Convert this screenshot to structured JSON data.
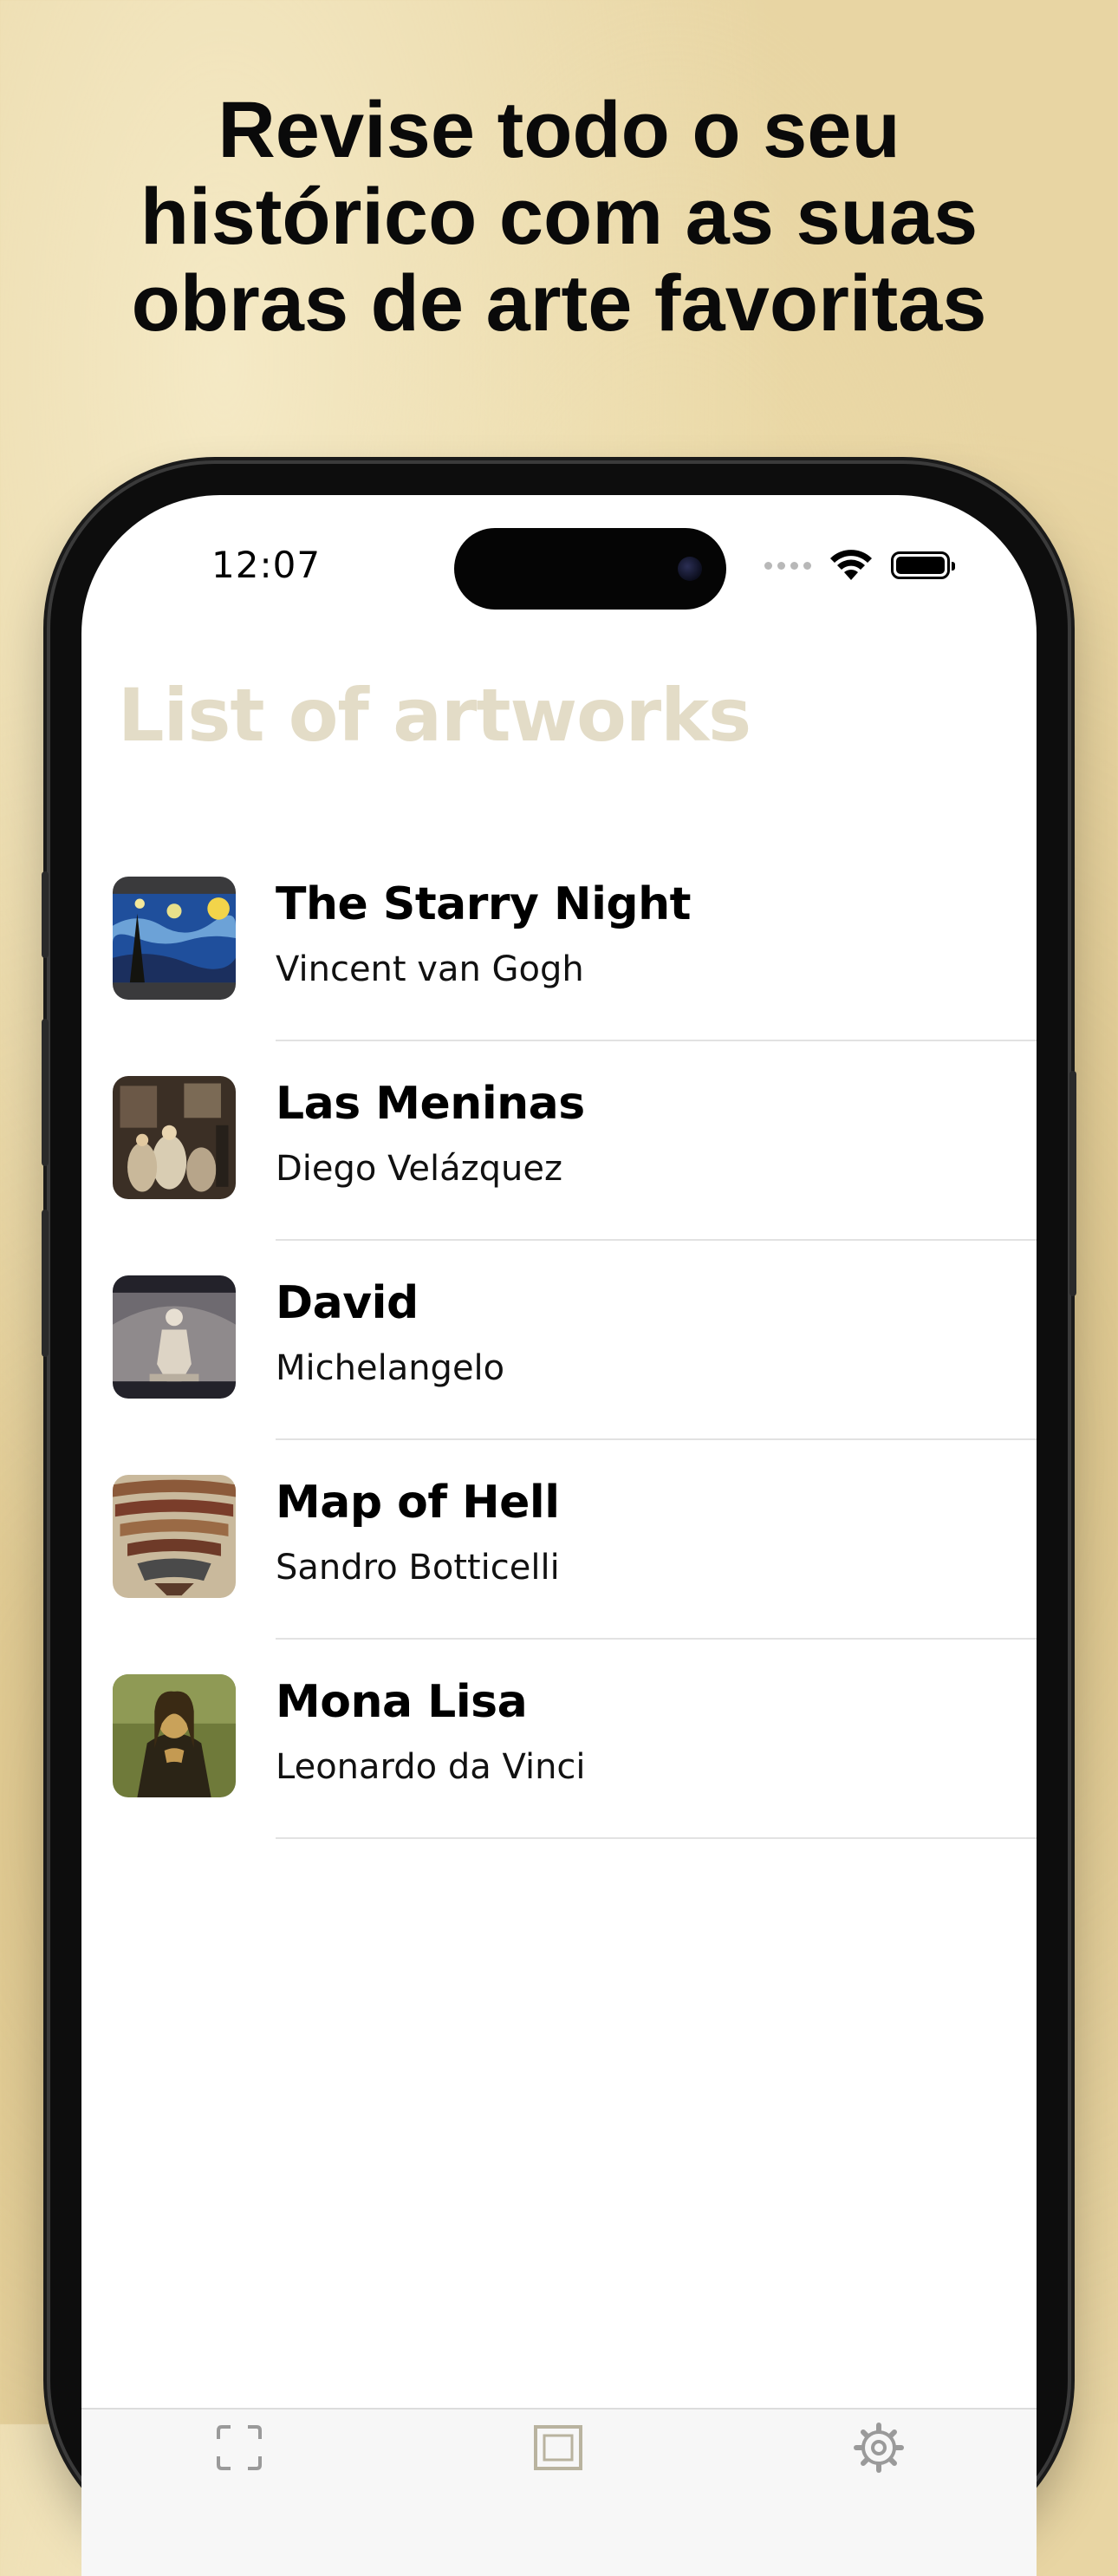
{
  "headline": {
    "line1": "Revise todo o seu",
    "line2": "histórico com as suas",
    "line3": "obras de arte favoritas"
  },
  "status_bar": {
    "time": "12:07",
    "icons": [
      "cellular-dots-icon",
      "wifi-icon",
      "battery-icon"
    ]
  },
  "screen": {
    "title": "List of artworks",
    "title_color": "#e3dcc7"
  },
  "artworks": [
    {
      "title": "The Starry Night",
      "artist": "Vincent van Gogh",
      "thumbnail": "starry-night-thumbnail"
    },
    {
      "title": "Las Meninas",
      "artist": "Diego Velázquez",
      "thumbnail": "las-meninas-thumbnail"
    },
    {
      "title": "David",
      "artist": "Michelangelo",
      "thumbnail": "david-thumbnail"
    },
    {
      "title": "Map of Hell",
      "artist": "Sandro Botticelli",
      "thumbnail": "map-of-hell-thumbnail"
    },
    {
      "title": "Mona Lisa",
      "artist": "Leonardo da Vinci",
      "thumbnail": "mona-lisa-thumbnail"
    }
  ],
  "tab_bar": {
    "tabs": [
      {
        "icon": "scan-icon"
      },
      {
        "icon": "artwork-frame-icon"
      },
      {
        "icon": "settings-gear-icon"
      }
    ]
  },
  "colors": {
    "background": "#e8d5a3",
    "text": "#000000",
    "divider": "#e2e2e2"
  }
}
